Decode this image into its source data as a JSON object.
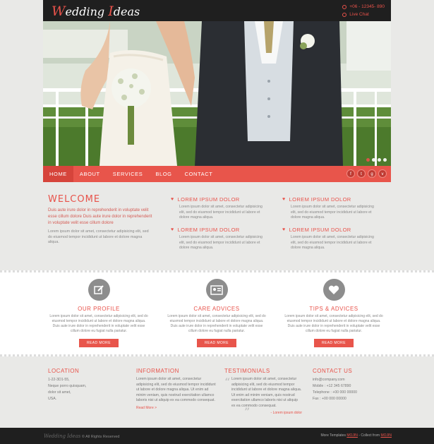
{
  "header": {
    "logo_first": "W",
    "logo_rest": "edding ",
    "logo_second": "I",
    "logo_end": "deas",
    "phone": "+06 - 12345- 890",
    "live_chat": "Live Chat"
  },
  "hero": {
    "slide_count": 4,
    "active_slide": 1
  },
  "nav": {
    "items": [
      "Home",
      "About",
      "Services",
      "Blog",
      "Contact"
    ],
    "active": "Home"
  },
  "social": [
    "f",
    "t",
    "g",
    "v"
  ],
  "welcome": {
    "title": "WELCOME",
    "lead": "Duis aute irure dolor in reprehenderit in voluptate velit esse cillum dolore Duis aute irure dolor in reprehenderit in voluptate velit esse cillum dolore",
    "text": "Lorem ipsum dolor sit amet, consectetur adipisicing elit, sed do eiusmod tempor incididunt ut labore et dolore magna aliqua."
  },
  "features": [
    {
      "title": "LOREM IPSUM DOLOR",
      "text": "Lorem ipsum dolor sit amet, consectetur adipisicing elit, sed do eiusmod tempor incididunt ut labore et dolore magna aliqua."
    },
    {
      "title": "LOREM IPSUM DOLOR",
      "text": "Lorem ipsum dolor sit amet, consectetur adipisicing elit, sed do eiusmod tempor incididunt ut labore et dolore magna aliqua."
    },
    {
      "title": "LOREM IPSUM DOLOR",
      "text": "Lorem ipsum dolor sit amet, consectetur adipisicing elit, sed do eiusmod tempor incididunt ut labore et dolore magna aliqua."
    },
    {
      "title": "LOREM IPSUM DOLOR",
      "text": "Lorem ipsum dolor sit amet, consectetur adipisicing elit, sed do eiusmod tempor incididunt ut labore et dolore magna aliqua."
    }
  ],
  "services": [
    {
      "icon": "edit-icon",
      "title": "OUR PROFILE",
      "text": "Lorem ipsum dolor sit amet, consectetur adipisicing elit, sed do eiusmod tempor incididunt ut labore et dolore magna aliqua. Duis aute irure dolor in reprehenderit in voluptate velit esse cillum dolore eu fugiat nulla pariatur.",
      "button": "READ MORE"
    },
    {
      "icon": "id-card-icon",
      "title": "CARE ADVICES",
      "text": "Lorem ipsum dolor sit amet, consectetur adipisicing elit, sed do eiusmod tempor incididunt ut labore et dolore magna aliqua. Duis aute irure dolor in reprehenderit in voluptate velit esse cillum dolore eu fugiat nulla pariatur.",
      "button": "READ MORE"
    },
    {
      "icon": "heart-icon",
      "title": "TIPS & ADVICES",
      "text": "Lorem ipsum dolor sit amet, consectetur adipisicing elit, sed do eiusmod tempor incididunt ut labore et dolore magna aliqua. Duis aute irure dolor in reprehenderit in voluptate velit esse cillum dolore eu fugiat nulla pariatur.",
      "button": "READ MORE"
    }
  ],
  "footer": {
    "location": {
      "title": "LOCATION",
      "lines": [
        "1-22-3D1-55,",
        "Neque porro quisquam,",
        "dolor sit amet,",
        "USA."
      ]
    },
    "information": {
      "title": "INFORMATION",
      "text": "Lorem ipsum dolor sit amet, consectetur adipisicing elit, sed do eiusmod tempor incididunt ut labore et dolore magna aliqua. Ut enim ad minim veniam, quis nostrud exercitation ullamco laboris nisi ut aliquip ex ea commodo consequat.",
      "more": "Read More  >"
    },
    "testimonials": {
      "title": "TESTIMONIALS",
      "text": "Lorem ipsum dolor sit amet, consectetur adipisicing elit, sed do eiusmod tempor incididunt ut labore et dolore magna aliqua. Ut enim ad minim veniam, quis nostrud exercitation ullamco laboris nisi ut aliquip ex ea commodo consequat.",
      "author": "- Lorem ipsum dolor"
    },
    "contact": {
      "title": "CONTACT US",
      "lines": [
        "info@company.com",
        "Mobile : +12 345 67890",
        "Telephone : +00 000 00000",
        "Fax : +00 000 00000"
      ]
    }
  },
  "bottom": {
    "brand": "Wedding Ideas",
    "rights": "© All Rights Reserved",
    "more_label": "More Templates",
    "more_link": "MOJIN",
    "collect_label": "- Collect from",
    "collect_link": "MOJIN"
  },
  "colors": {
    "accent": "#e8554b",
    "dark": "#1f1f1f",
    "bg": "#e9e9e7"
  }
}
